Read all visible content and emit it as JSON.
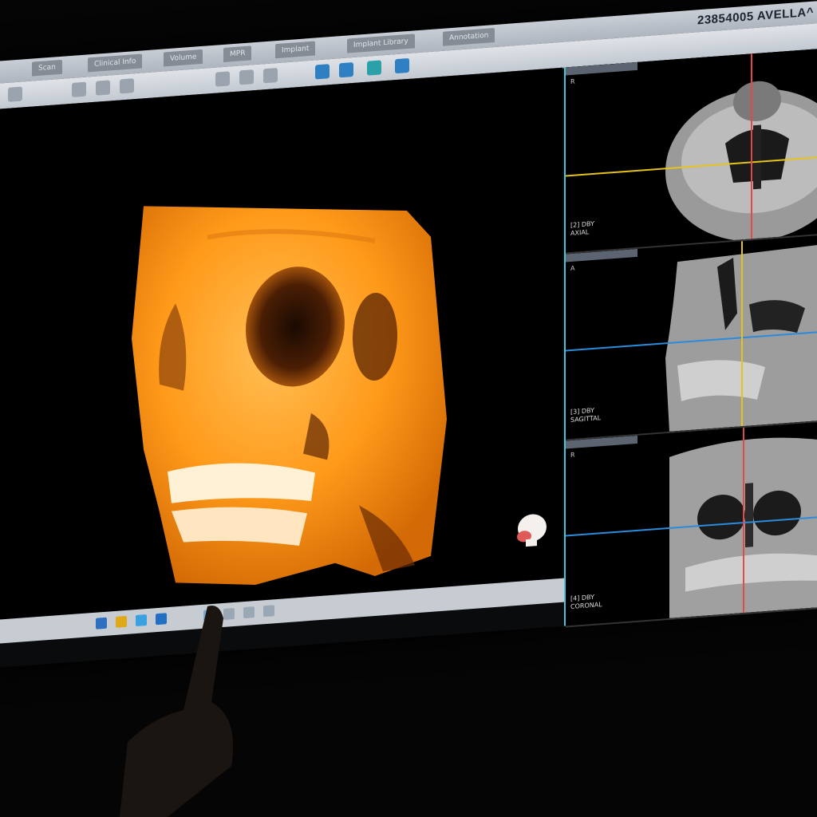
{
  "window": {
    "tabs": [
      "Scan",
      "Clinical Info",
      "Volume",
      "MPR",
      "Implant",
      "Implant Library",
      "Annotation"
    ],
    "patient_header": "23854005 AVELLA^"
  },
  "toolbar": {
    "icons": [
      "select-icon",
      "rotate-icon",
      "zoom-icon",
      "pan-icon",
      "measure-icon",
      "angle-icon",
      "window-level-icon",
      "layout-icon",
      "camera-icon",
      "export-icon",
      "settings-icon"
    ]
  },
  "views": {
    "volume_3d": {
      "name": "3D volume rendering",
      "colormap": "#ff9a1a"
    },
    "axial": {
      "corner": "R",
      "label_line1": "[2] DBY",
      "label_line2": "AXIAL"
    },
    "sagittal": {
      "corner": "A",
      "label_line1": "[3] DBY",
      "label_line2": "SAGITTAL"
    },
    "coronal": {
      "corner": "R",
      "label_line1": "[4] DBY",
      "label_line2": "CORONAL"
    }
  },
  "colors": {
    "crosshair_red": "#e24a4a",
    "crosshair_yellow": "#e6c21c",
    "crosshair_blue": "#2b8bdc",
    "pane_border": "#4cc2d9",
    "volume_orange": "#ff9a1a"
  }
}
